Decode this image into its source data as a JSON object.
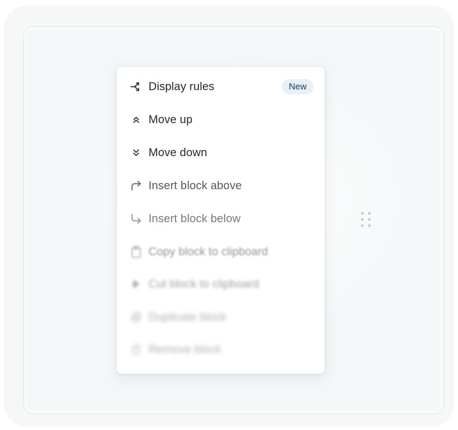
{
  "menu": {
    "items": [
      {
        "label": "Display rules",
        "icon": "display-rules-icon",
        "badge": "New"
      },
      {
        "label": "Move up",
        "icon": "chevrons-up-icon"
      },
      {
        "label": "Move down",
        "icon": "chevrons-down-icon"
      },
      {
        "label": "Insert block above",
        "icon": "insert-above-arrow-icon"
      },
      {
        "label": "Insert block below",
        "icon": "insert-below-arrow-icon"
      },
      {
        "label": "Copy block to clipboard",
        "icon": "clipboard-icon"
      },
      {
        "label": "Cut block to clipboard",
        "icon": "cut-icon"
      },
      {
        "label": "Duplicate block",
        "icon": "duplicate-icon"
      },
      {
        "label": "Remove block",
        "icon": "trash-icon"
      }
    ]
  },
  "handle": {
    "icon": "drag-handle-icon"
  },
  "colors": {
    "text": "#22262b",
    "muted_text": "#4e5660",
    "badge_bg": "#e7f0f6",
    "badge_text": "#1d3c5a",
    "card_bg": "#ffffff",
    "canvas_bg": "#f4f7f8"
  }
}
